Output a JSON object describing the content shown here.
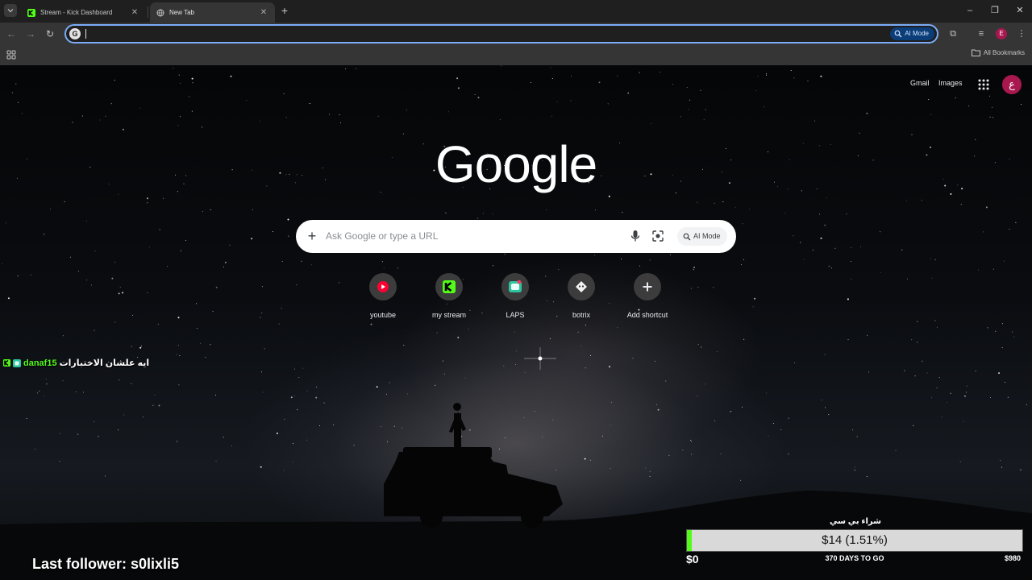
{
  "tabs": [
    {
      "title": "Stream - Kick Dashboard",
      "icon": "kick-icon"
    },
    {
      "title": "New Tab",
      "icon": "globe-icon"
    }
  ],
  "omnibox": {
    "value": "",
    "ai_mode_label": "AI Mode"
  },
  "bookmarks_bar": {
    "all_bookmarks_label": "All Bookmarks"
  },
  "profile_initial": "E",
  "page": {
    "top_links": {
      "gmail": "Gmail",
      "images": "Images"
    },
    "avatar_initial": "ع",
    "logo_text": "Google",
    "search": {
      "placeholder": "Ask Google or type a URL",
      "ai_mode_label": "AI Mode"
    },
    "shortcuts": [
      {
        "label": "youtube",
        "icon": "youtube-icon"
      },
      {
        "label": "my stream",
        "icon": "kick-icon"
      },
      {
        "label": "LAPS",
        "icon": "laps-icon"
      },
      {
        "label": "botrix",
        "icon": "botrix-icon"
      },
      {
        "label": "Add shortcut",
        "icon": "plus-icon"
      }
    ]
  },
  "overlay": {
    "chat": {
      "username": "danaf15",
      "message": "ايه علشان الاختبارات"
    },
    "last_follower": "Last follower: s0lixli5",
    "goal": {
      "title": "شراء بي سي",
      "amount_text": "$14 (1.51%)",
      "progress_percent": 1.51,
      "min_label": "$0",
      "days_label": "370 DAYS TO GO",
      "max_label": "$980"
    }
  },
  "colors": {
    "kick_green": "#53fc18",
    "accent_blue": "#7cacf8",
    "avatar_bg": "#a8184f",
    "youtube_red": "#ff0033"
  }
}
